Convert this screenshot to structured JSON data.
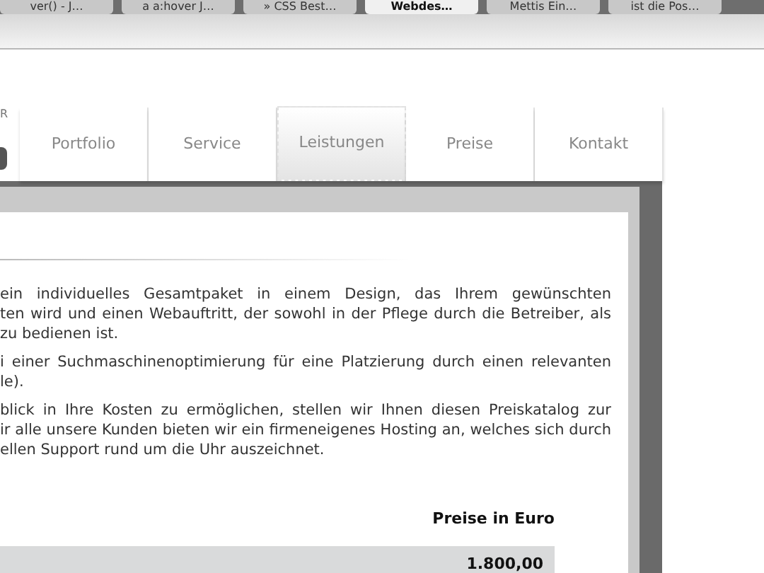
{
  "browser_tabs": [
    {
      "label": "ver() - J…",
      "selected": false
    },
    {
      "label": "a a:hover J…",
      "selected": false
    },
    {
      "label": "» CSS Best…",
      "selected": false
    },
    {
      "label": "Webdes…",
      "selected": true
    },
    {
      "label": "Mettis Ein…",
      "selected": false
    },
    {
      "label": "ist die Pos…",
      "selected": false
    }
  ],
  "logo": {
    "text": "R"
  },
  "nav": [
    {
      "label": "Portfolio",
      "selected": false
    },
    {
      "label": "Service",
      "selected": false
    },
    {
      "label": "Leistungen",
      "selected": true
    },
    {
      "label": "Preise",
      "selected": false
    },
    {
      "label": "Kontakt",
      "selected": false
    }
  ],
  "paragraphs": [
    [
      "ein individuelles Gesamtpaket in einem Design, das Ihrem gewünschten",
      "ten wird und einen Webauftritt, der sowohl in der Pflege durch die Betreiber, als",
      "zu bedienen ist."
    ],
    [
      "i einer Suchmaschinenoptimierung für eine Platzierung durch einen relevanten",
      "le)."
    ],
    [
      "blick in Ihre Kosten zu ermöglichen, stellen wir Ihnen diesen Preiskatalog zur",
      "ir alle unsere Kunden bieten wir ein firmeneigenes Hosting an, welches sich durch",
      "ellen Support rund um die Uhr auszeichnet."
    ]
  ],
  "price_table": {
    "header": "Preise in Euro",
    "rows": [
      {
        "price": "1.800,00"
      }
    ]
  }
}
